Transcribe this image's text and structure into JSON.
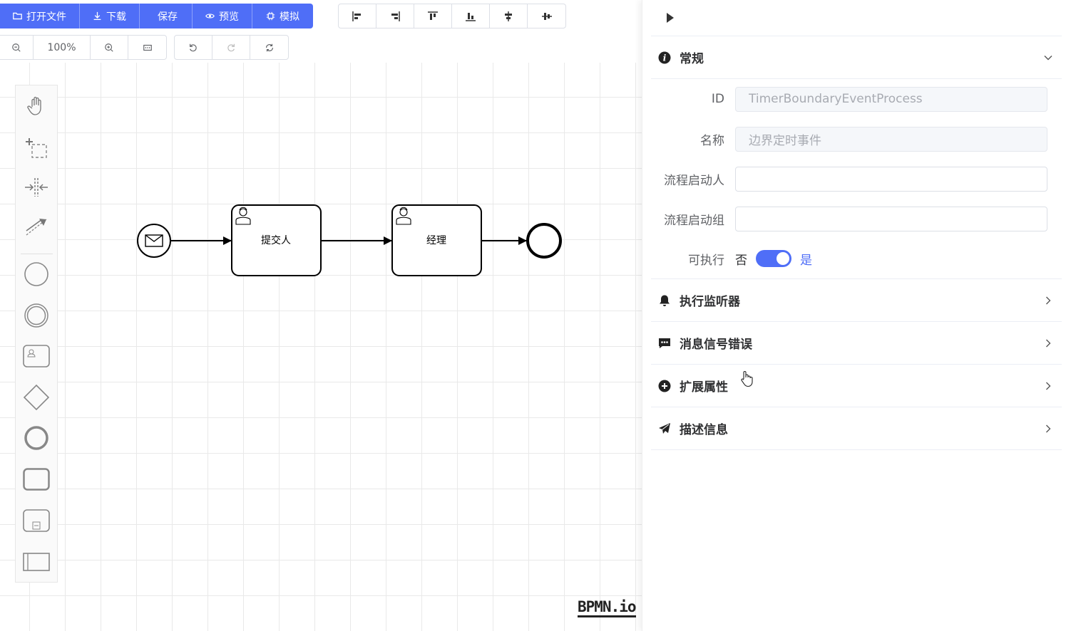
{
  "toolbar": {
    "open_file": "打开文件",
    "download": "下载",
    "save": "保存",
    "preview": "预览",
    "simulate": "模拟",
    "zoom_level": "100%"
  },
  "align_tools": [
    "align-left-icon",
    "align-right-icon",
    "align-top-icon",
    "align-bottom-icon",
    "align-center-icon",
    "align-middle-icon"
  ],
  "palette": [
    "hand-tool",
    "lasso-tool",
    "space-tool",
    "global-connect-tool",
    "start-event",
    "intermediate-event",
    "user-task",
    "gateway",
    "end-event",
    "task",
    "subprocess",
    "pool"
  ],
  "diagram": {
    "task1_label": "提交人",
    "task2_label": "经理"
  },
  "brand": "BPMN.io",
  "panel": {
    "general_title": "常规",
    "fields": {
      "id_label": "ID",
      "id_value": "TimerBoundaryEventProcess",
      "name_label": "名称",
      "name_value": "边界定时事件",
      "initiator_label": "流程启动人",
      "initiator_value": "",
      "group_label": "流程启动组",
      "group_value": "",
      "executable_label": "可执行",
      "executable_off": "否",
      "executable_on": "是",
      "executable_checked": true
    },
    "sections": {
      "listeners": "执行监听器",
      "messages": "消息信号错误",
      "extensions": "扩展属性",
      "description": "描述信息"
    }
  },
  "colors": {
    "accent": "#4f6ef7",
    "text": "#303133",
    "border": "#dcdfe6"
  }
}
